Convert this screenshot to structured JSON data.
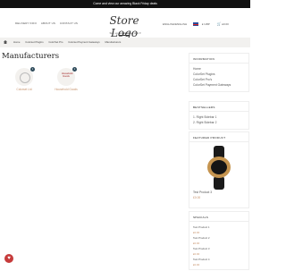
{
  "topbar": {
    "text": "Come and view our amazing Black Friday deals"
  },
  "nav": {
    "links": [
      "DELIVERY INFO",
      "ABOUT US",
      "CONTACT US"
    ]
  },
  "logo": {
    "text": "Store Logo"
  },
  "header_right": {
    "language": "ENGLISH/ENGLISH",
    "currency": "£ GBP",
    "cart": "£0.00"
  },
  "subheader": {
    "text_before": "Sign up ",
    "link": "& receive",
    "text_after": " an offer ▾"
  },
  "breadcrumb": [
    "Home",
    "Colorset Plugins",
    "ColorSet Pro",
    "Colorset Payment Gateways",
    "Manufacturers"
  ],
  "page": {
    "title": "Manufacturers"
  },
  "manufacturers": [
    {
      "name": "Colorset Ltd",
      "count": "1"
    },
    {
      "name": "Household Goods",
      "count": "1",
      "logo_text": "Household Goods"
    }
  ],
  "sidebar": {
    "info": {
      "title": "INFORMATION",
      "items": [
        "Home",
        "ColorSet Plugins",
        "ColorSet Pro's",
        "ColorSet Payment Gateways"
      ]
    },
    "bestsellers": {
      "title": "BESTSELLERS",
      "items": [
        "Right Sidebar 1",
        "Right Sidebar 2"
      ]
    },
    "featured": {
      "title": "FEATURED PRODUCT",
      "product": "Test Product 3",
      "price": "£0.00"
    },
    "specials": {
      "title": "SPECIALS",
      "items": [
        {
          "name": "Test Product 1",
          "price": "£0.00"
        },
        {
          "name": "Test Product 2",
          "price": "£0.00"
        },
        {
          "name": "Test Product 3",
          "price": "£0.00"
        },
        {
          "name": "Test Product 4",
          "price": "£0.00"
        }
      ]
    }
  },
  "favorites": {
    "icon": "heart-icon"
  }
}
